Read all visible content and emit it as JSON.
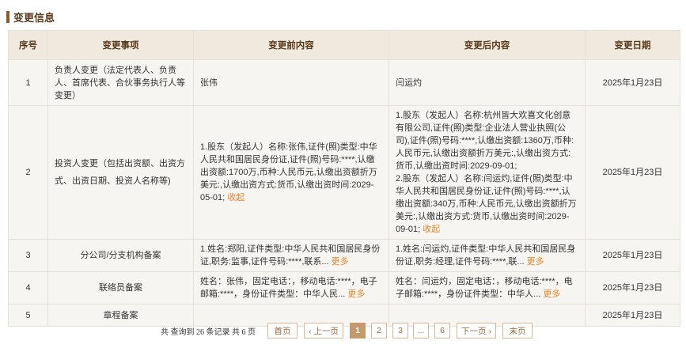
{
  "section": {
    "title": "变更信息"
  },
  "table": {
    "headers": [
      "序号",
      "变更事项",
      "变更前内容",
      "变更后内容",
      "变更日期"
    ],
    "rows": [
      {
        "no": "1",
        "item": "负责人变更（法定代表人、负责人、首席代表、合伙事务执行人等变更）",
        "before": "张伟",
        "before_more": "",
        "after": "闫运灼",
        "after_more": "",
        "date": "2025年1月23日"
      },
      {
        "no": "2",
        "item": "投资人变更（包括出资额、出资方式、出资日期、投资人名称等)",
        "before": "1.股东（发起人）名称:张伟,证件(照)类型:中华人民共和国居民身份证,证件(照)号码:****,认缴出资额:1700万,币种:人民币元,认缴出资额折万美元:,认缴出资方式:货币,认缴出资时间:2029-05-01;",
        "before_more": "收起",
        "after": "1.股东（发起人）名称:杭州皆大欢喜文化创意有限公司,证件(照)类型:企业法人营业执照(公司),证件(照)号码:****,认缴出资额:1360万,币种:人民币元,认缴出资额折万美元:,认缴出资方式:货币,认缴出资时间:2029-09-01;\n2.股东（发起人）名称:闫运灼,证件(照)类型:中华人民共和国居民身份证,证件(照)号码:****,认缴出资额:340万,币种:人民币元,认缴出资额折万美元:,认缴出资方式:货币,认缴出资时间:2029-09-01;",
        "after_more": "收起",
        "date": "2025年1月23日"
      },
      {
        "no": "3",
        "item": "分公司/分支机构备案",
        "before": "1.姓名:郑阳,证件类型:中华人民共和国居民身份证,职务:监事,证件号码:****,联系...",
        "before_more": "更多",
        "after": "1.姓名:闫运灼,证件类型:中华人民共和国居民身份证,职务:经理,证件号码:****,联...",
        "after_more": "更多",
        "date": "2025年1月23日"
      },
      {
        "no": "4",
        "item": "联络员备案",
        "before": "姓名：张伟，固定电话：，移动电话:****，电子邮箱:****，身份证件类型：中华人民...",
        "before_more": "更多",
        "after": "姓名：闫运灼，固定电话：，移动电话:****，电子邮箱:****，身份证件类型：中华人...",
        "after_more": "更多",
        "date": "2025年1月23日"
      },
      {
        "no": "5",
        "item": "章程备案",
        "before": "",
        "before_more": "",
        "after": "",
        "after_more": "",
        "date": "2025年1月23日"
      }
    ]
  },
  "pager": {
    "summary": "共 查询到 26 条记录 共 6 页",
    "first": "首页",
    "prev": "‹ 上一页",
    "pages": [
      "1",
      "2",
      "3",
      "...",
      "6"
    ],
    "next": "下一页 ›",
    "last": "末页",
    "current": "1"
  },
  "colors": {
    "accent": "#c49a6c",
    "header_bg": "#f0e9de",
    "link": "#e8872e"
  }
}
